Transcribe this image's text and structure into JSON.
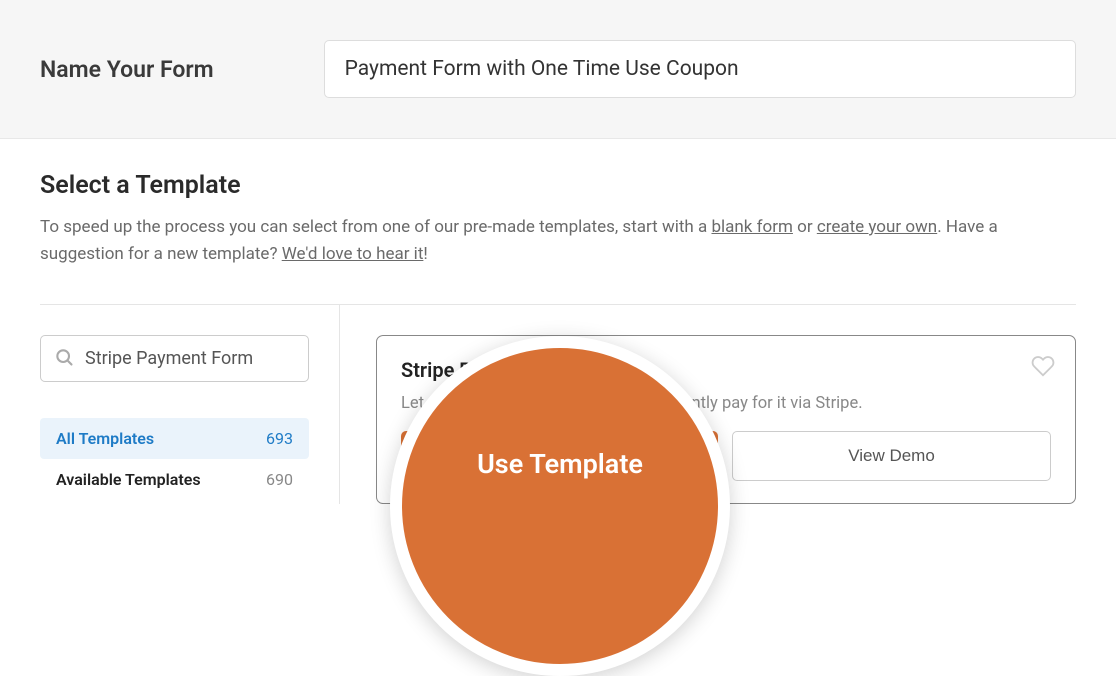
{
  "header": {
    "label": "Name Your Form",
    "form_name": "Payment Form with One Time Use Coupon"
  },
  "template_section": {
    "title": "Select a Template",
    "desc_part1": "To speed up the process you can select from one of our pre-made templates, start with a ",
    "link1": "blank form",
    "desc_part2": " or ",
    "link2": "create your own",
    "desc_part3": ". Have a suggestion for a new template? ",
    "link3": "We'd love to hear it",
    "desc_part4": "!"
  },
  "sidebar": {
    "search_value": "Stripe Payment Form",
    "categories": [
      {
        "label": "All Templates",
        "count": "693",
        "active": true
      },
      {
        "label": "Available Templates",
        "count": "690",
        "active": false
      }
    ]
  },
  "template_card": {
    "title": "Stripe Payment Form",
    "description_visible_left": "Let your vi",
    "description_visible_right": "instantly pay for it via Stripe.",
    "use_button": "Use Template",
    "demo_button": "View Demo"
  },
  "zoom": {
    "label": "Use Template"
  }
}
